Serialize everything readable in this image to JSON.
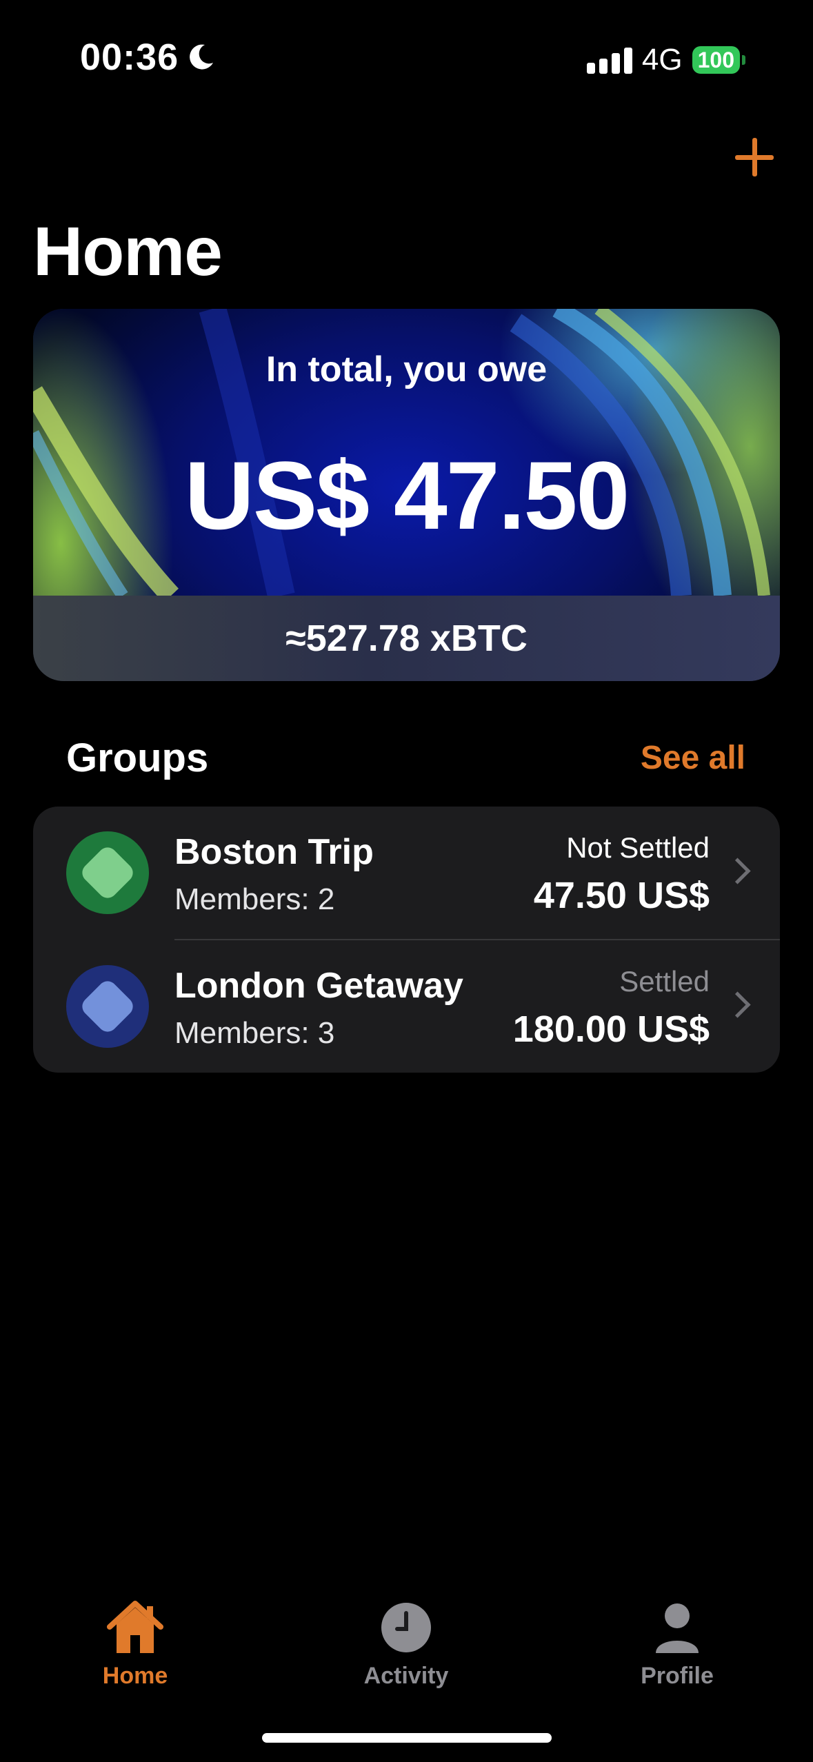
{
  "status_bar": {
    "time": "00:36",
    "network": "4G",
    "battery": "100"
  },
  "header": {
    "title": "Home"
  },
  "balance_card": {
    "subtitle": "In total, you owe",
    "amount": "US$ 47.50",
    "crypto_equivalent": "≈527.78 xBTC"
  },
  "groups": {
    "title": "Groups",
    "see_all_label": "See all",
    "items": [
      {
        "name": "Boston Trip",
        "members": "Members: 2",
        "status": "Not Settled",
        "amount": "47.50 US$",
        "avatar_color": "#1e7a3c",
        "avatar_inner_color": "#7fcf8c",
        "status_color": "#ffffff"
      },
      {
        "name": "London Getaway",
        "members": "Members: 3",
        "status": "Settled",
        "amount": "180.00 US$",
        "avatar_color": "#1f2f7a",
        "avatar_inner_color": "#7391db",
        "status_color": "#8e8e93"
      }
    ]
  },
  "tab_bar": {
    "tabs": [
      {
        "label": "Home",
        "icon": "house-icon",
        "active": true
      },
      {
        "label": "Activity",
        "icon": "clock-icon",
        "active": false
      },
      {
        "label": "Profile",
        "icon": "person-icon",
        "active": false
      }
    ]
  },
  "colors": {
    "accent": "#e07a2b",
    "background": "#000000",
    "card": "#1c1c1e"
  }
}
